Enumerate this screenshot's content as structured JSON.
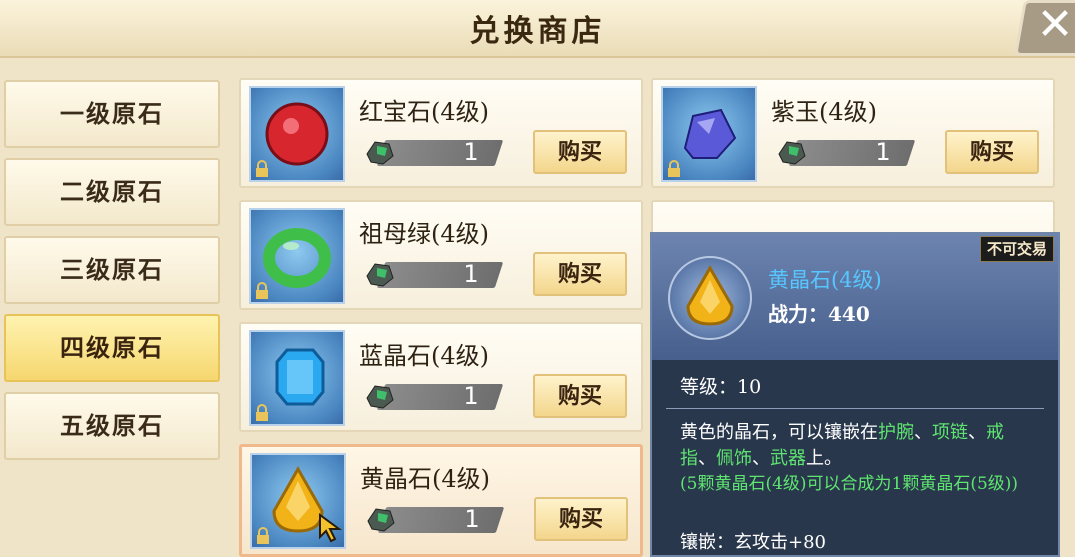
{
  "header": {
    "title": "兑换商店"
  },
  "sidebar": {
    "categories": [
      {
        "label": "一级原石"
      },
      {
        "label": "二级原石"
      },
      {
        "label": "三级原石"
      },
      {
        "label": "四级原石"
      },
      {
        "label": "五级原石"
      }
    ],
    "active_index": 3
  },
  "items": [
    {
      "name": "红宝石(4级)",
      "qty": "1",
      "buy": "购买",
      "gem_color": "#d8262f",
      "icon": "ruby-icon"
    },
    {
      "name": "紫玉(4级)",
      "qty": "1",
      "buy": "购买",
      "gem_color": "#5a5ad8",
      "icon": "purple-jade-icon"
    },
    {
      "name": "祖母绿(4级)",
      "qty": "1",
      "buy": "购买",
      "gem_color": "#3fbf4a",
      "icon": "emerald-icon"
    },
    {
      "name": "蓝晶石(4级)",
      "qty": "1",
      "buy": "购买",
      "gem_color": "#2aa8f0",
      "icon": "blue-crystal-icon"
    },
    {
      "name": "黄晶石(4级)",
      "qty": "1",
      "buy": "购买",
      "gem_color": "#f2b318",
      "icon": "topaz-icon"
    }
  ],
  "tooltip": {
    "badge": "不可交易",
    "name": "黄晶石(4级)",
    "power": "战力：440",
    "level": "等级：10",
    "desc_prefix": "黄色的晶石，可以镶嵌在",
    "desc_slots_1": "护腕",
    "desc_sep_1": "、",
    "desc_slots_2": "项链",
    "desc_sep_2": "、",
    "desc_slots_3": "戒指",
    "desc_sep_3": "、",
    "desc_slots_4": "佩饰",
    "desc_sep_4": "、",
    "desc_slots_5": "武器",
    "desc_suffix": "上。",
    "synth": "(5颗黄晶石(4级)可以合成为1颗黄晶石(5级))",
    "inlay": "镶嵌：玄攻击+80"
  },
  "colors": {
    "accent_gold": "#f6d770",
    "tooltip_bg": "#182842",
    "tooltip_name": "#57c7ff",
    "green_text": "#5ee56f"
  }
}
